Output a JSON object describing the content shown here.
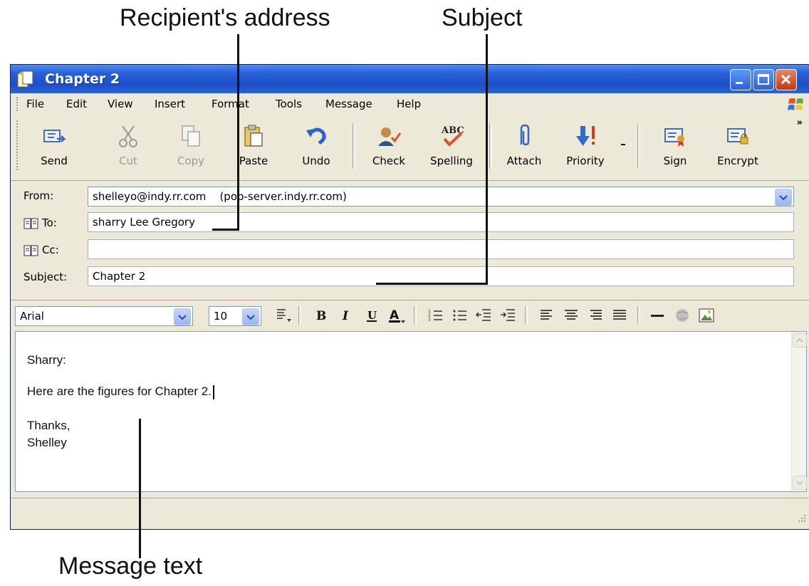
{
  "callouts": {
    "recipient": "Recipient's address",
    "subject": "Subject",
    "message": "Message text"
  },
  "window": {
    "title": "Chapter 2"
  },
  "menu": [
    "File",
    "Edit",
    "View",
    "Insert",
    "Format",
    "Tools",
    "Message",
    "Help"
  ],
  "toolbar": {
    "send": "Send",
    "cut": "Cut",
    "copy": "Copy",
    "paste": "Paste",
    "undo": "Undo",
    "check": "Check",
    "spelling": "Spelling",
    "attach": "Attach",
    "priority": "Priority",
    "sign": "Sign",
    "encrypt": "Encrypt",
    "more": "»"
  },
  "header": {
    "from_label": "From:",
    "from_value": "shelleyo@indy.rr.com    (pop-server.indy.rr.com)",
    "to_label": "To:",
    "to_value": "sharry Lee Gregory",
    "cc_label": "Cc:",
    "cc_value": "",
    "subject_label": "Subject:",
    "subject_value": "Chapter 2"
  },
  "format": {
    "font": "Arial",
    "size": "10"
  },
  "message": {
    "line1": "Sharry:",
    "line2": "Here are the figures for Chapter 2.",
    "line3": "Thanks,",
    "line4": "Shelley"
  },
  "colors": {
    "titlebar": "#2760d8",
    "chrome": "#ece9d8",
    "field_border": "#7f9db9"
  }
}
